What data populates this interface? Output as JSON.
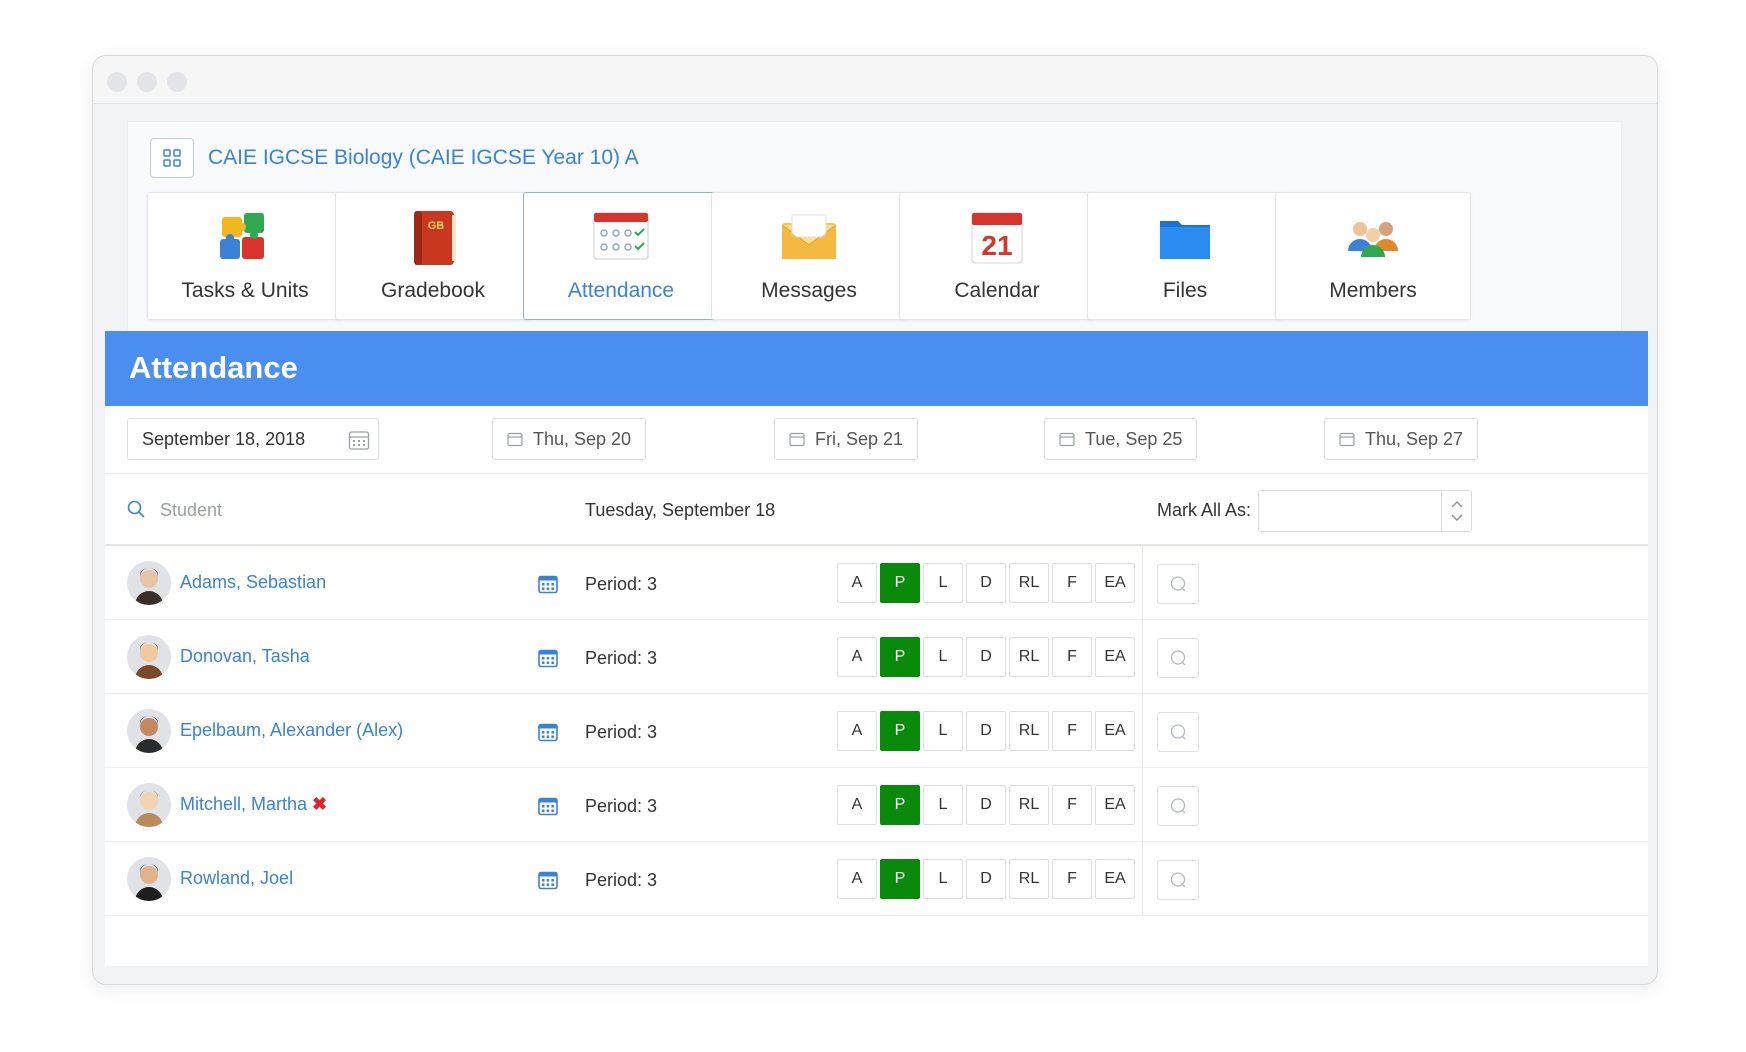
{
  "course": {
    "title": "CAIE IGCSE Biology (CAIE IGCSE Year 10) A"
  },
  "nav": [
    {
      "label": "Tasks & Units",
      "icon": "puzzle-icon"
    },
    {
      "label": "Gradebook",
      "icon": "gradebook-icon",
      "badge": "GB"
    },
    {
      "label": "Attendance",
      "icon": "attendance-sheet-icon",
      "active": true
    },
    {
      "label": "Messages",
      "icon": "envelope-icon"
    },
    {
      "label": "Calendar",
      "icon": "calendar-21-icon",
      "day": "21"
    },
    {
      "label": "Files",
      "icon": "folder-icon"
    },
    {
      "label": "Members",
      "icon": "people-icon"
    }
  ],
  "attendance": {
    "title": "Attendance",
    "date_value": "September 18, 2018",
    "date_chips": [
      "Thu, Sep 20",
      "Fri, Sep 21",
      "Tue, Sep 25",
      "Thu, Sep 27"
    ],
    "search_placeholder": "Student",
    "day_label": "Tuesday, September 18",
    "mark_all_label": "Mark All As:",
    "codes": [
      "A",
      "P",
      "L",
      "D",
      "RL",
      "F",
      "EA"
    ],
    "students": [
      {
        "name": "Adams, Sebastian",
        "period": "Period: 3",
        "status": "P",
        "flag": false
      },
      {
        "name": "Donovan, Tasha",
        "period": "Period: 3",
        "status": "P",
        "flag": false
      },
      {
        "name": "Epelbaum, Alexander (Alex)",
        "period": "Period: 3",
        "status": "P",
        "flag": false
      },
      {
        "name": "Mitchell, Martha",
        "period": "Period: 3",
        "status": "P",
        "flag": true
      },
      {
        "name": "Rowland, Joel",
        "period": "Period: 3",
        "status": "P",
        "flag": false
      }
    ]
  },
  "colors": {
    "accent": "#4a8ff0",
    "link": "#3a82d6",
    "present": "#0a8a0a",
    "flag": "#e02424"
  }
}
